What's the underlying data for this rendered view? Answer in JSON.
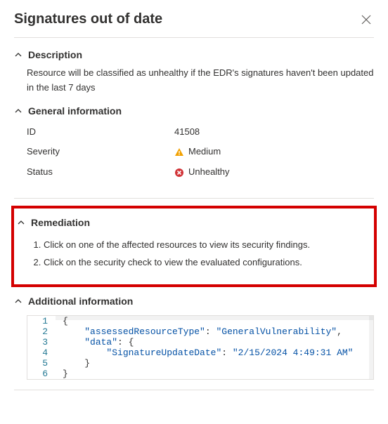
{
  "header": {
    "title": "Signatures out of date"
  },
  "sections": {
    "description": {
      "title": "Description",
      "body": "Resource will be classified as unhealthy if the EDR's signatures haven't been updated in the last 7 days"
    },
    "general": {
      "title": "General information",
      "rows": [
        {
          "label": "ID",
          "value": "41508",
          "icon": null
        },
        {
          "label": "Severity",
          "value": "Medium",
          "icon": "warning"
        },
        {
          "label": "Status",
          "value": "Unhealthy",
          "icon": "error"
        }
      ]
    },
    "remediation": {
      "title": "Remediation",
      "steps": [
        "Click on one of the affected resources to view its security findings.",
        "Click on the security check to view the evaluated configurations."
      ]
    },
    "additional": {
      "title": "Additional information",
      "code": {
        "lines": [
          {
            "n": "1",
            "indent": "",
            "parts": [
              {
                "t": "brace",
                "v": "{"
              }
            ]
          },
          {
            "n": "2",
            "indent": "    ",
            "parts": [
              {
                "t": "key",
                "v": "\"assessedResourceType\""
              },
              {
                "t": "colon",
                "v": ": "
              },
              {
                "t": "str",
                "v": "\"GeneralVulnerability\""
              },
              {
                "t": "colon",
                "v": ","
              }
            ]
          },
          {
            "n": "3",
            "indent": "    ",
            "parts": [
              {
                "t": "key",
                "v": "\"data\""
              },
              {
                "t": "colon",
                "v": ": "
              },
              {
                "t": "brace",
                "v": "{"
              }
            ]
          },
          {
            "n": "4",
            "indent": "        ",
            "parts": [
              {
                "t": "key",
                "v": "\"SignatureUpdateDate\""
              },
              {
                "t": "colon",
                "v": ": "
              },
              {
                "t": "str",
                "v": "\"2/15/2024 4:49:31 AM\""
              }
            ]
          },
          {
            "n": "5",
            "indent": "    ",
            "parts": [
              {
                "t": "brace",
                "v": "}"
              }
            ]
          },
          {
            "n": "6",
            "indent": "",
            "parts": [
              {
                "t": "brace",
                "v": "}"
              }
            ]
          }
        ]
      }
    }
  }
}
